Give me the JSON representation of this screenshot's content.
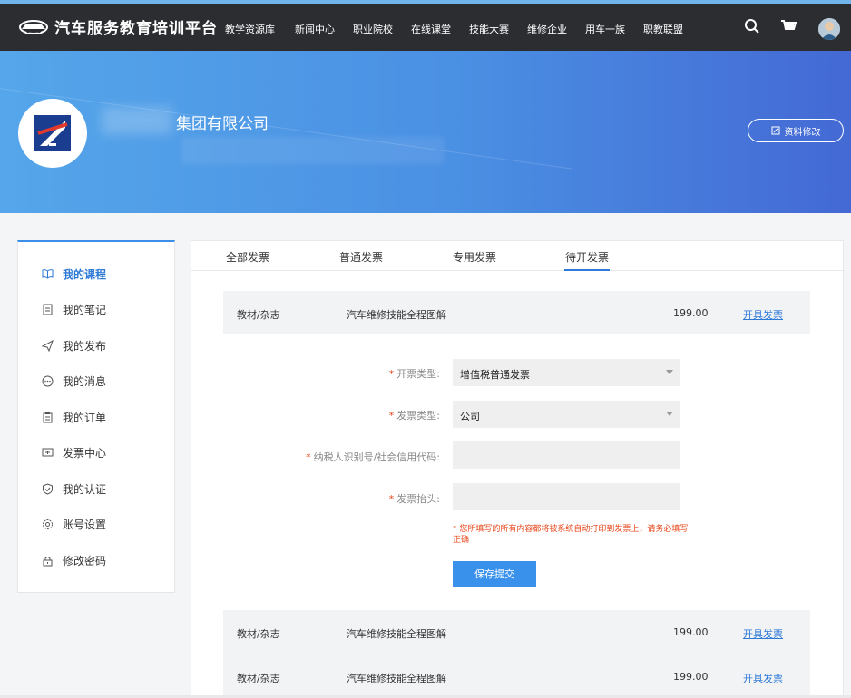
{
  "brand": {
    "title": "汽车服务教育培训平台"
  },
  "nav": [
    "教学资源库",
    "新闻中心",
    "职业院校",
    "在线课堂",
    "技能大赛",
    "维修企业",
    "用车一族",
    "职教联盟"
  ],
  "banner": {
    "company": "集团有限公司",
    "edit_label": "资料修改"
  },
  "sidebar": {
    "items": [
      "我的课程",
      "我的笔记",
      "我的发布",
      "我的消息",
      "我的订单",
      "发票中心",
      "我的认证",
      "账号设置",
      "修改密码"
    ]
  },
  "tabs": [
    "全部发票",
    "普通发票",
    "专用发票",
    "待开发票"
  ],
  "rows": [
    {
      "category": "教材/杂志",
      "title": "汽车维修技能全程图解",
      "price": "199.00",
      "action": "开具发票"
    },
    {
      "category": "教材/杂志",
      "title": "汽车维修技能全程图解",
      "price": "199.00",
      "action": "开具发票"
    },
    {
      "category": "教材/杂志",
      "title": "汽车维修技能全程图解",
      "price": "199.00",
      "action": "开具发票"
    }
  ],
  "form": {
    "star": "*",
    "invoice_kind_label": "开票类型:",
    "invoice_kind_value": "增值税普通发票",
    "invoice_type_label": "发票类型:",
    "invoice_type_value": "公司",
    "tax_id_label": "纳税人识别号/社会信用代码:",
    "header_label": "发票抬头:",
    "notice": "* 您所填写的所有内容都将被系统自动打印到发票上，请务必填写正确",
    "submit": "保存提交"
  },
  "colors": {
    "accent": "#3a91ec",
    "topbar": "#2b2d31",
    "warning": "#e8461a"
  }
}
